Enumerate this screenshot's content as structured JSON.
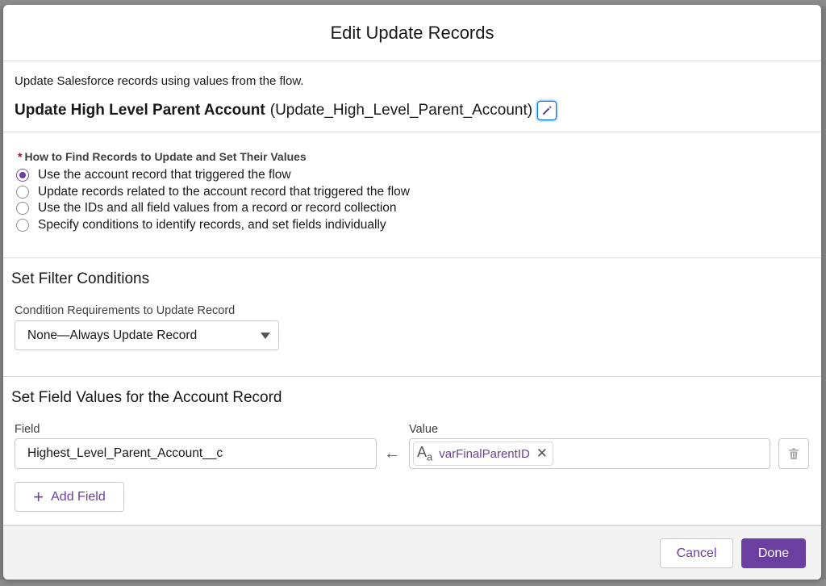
{
  "modal": {
    "title": "Edit Update Records"
  },
  "intro": {
    "description": "Update Salesforce records using values from the flow.",
    "element_label": "Update High Level Parent Account",
    "element_api_name": "(Update_High_Level_Parent_Account)",
    "edit_icon": "pencil-icon"
  },
  "how_to_find": {
    "required_marker": "*",
    "label": "How to Find Records to Update and Set Their Values",
    "options": [
      {
        "label": "Use the account record that triggered the flow",
        "selected": true
      },
      {
        "label": "Update records related to the account record that triggered the flow",
        "selected": false
      },
      {
        "label": "Use the IDs and all field values from a record or record collection",
        "selected": false
      },
      {
        "label": "Specify conditions to identify records, and set fields individually",
        "selected": false
      }
    ]
  },
  "filter": {
    "title": "Set Filter Conditions",
    "condition_label": "Condition Requirements to Update Record",
    "condition_value": "None—Always Update Record"
  },
  "field_values": {
    "title": "Set Field Values for the Account Record",
    "field_header": "Field",
    "value_header": "Value",
    "rows": [
      {
        "field": "Highest_Level_Parent_Account__c",
        "value_icon": "text-type-icon",
        "value": "varFinalParentID"
      }
    ],
    "add_field_label": "Add Field"
  },
  "footer": {
    "cancel_label": "Cancel",
    "done_label": "Done"
  },
  "colors": {
    "brand_purple": "#6b3fa0",
    "required_red": "#ba0517",
    "focus_blue": "#0176d3"
  }
}
